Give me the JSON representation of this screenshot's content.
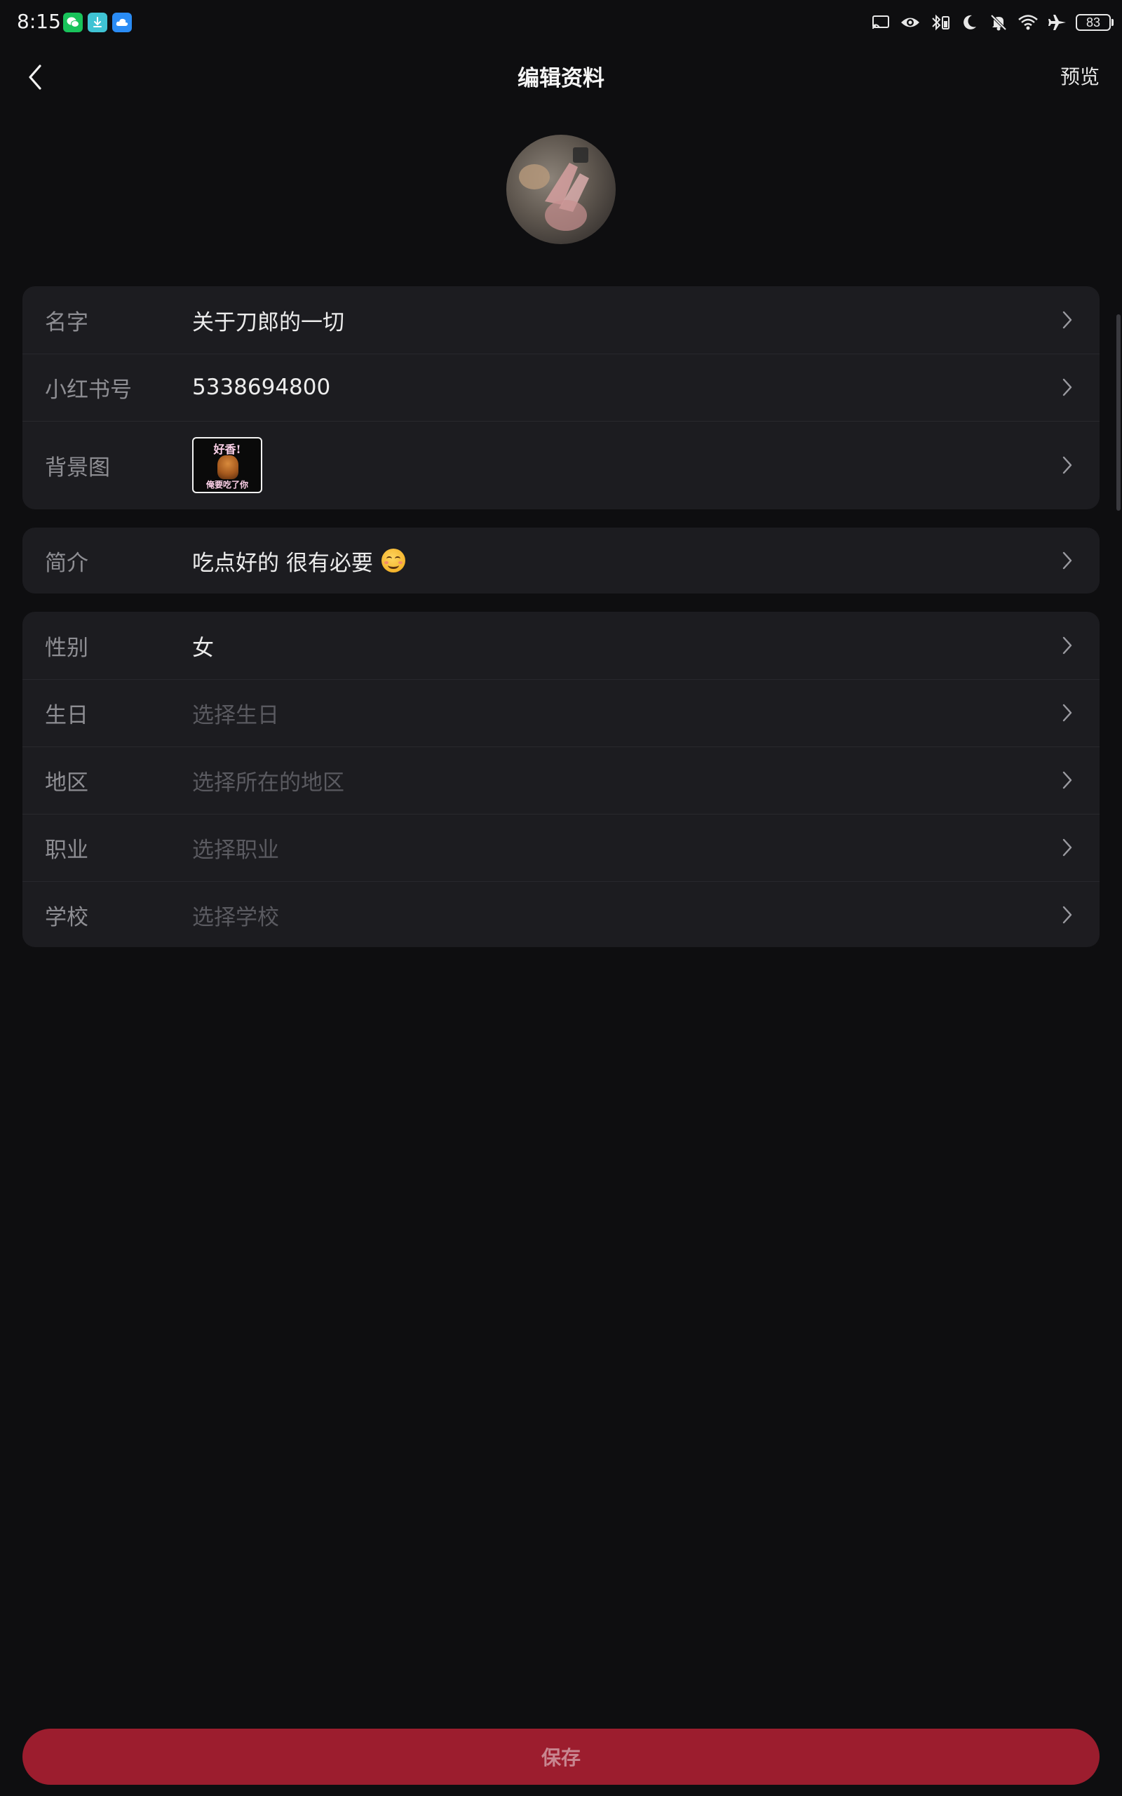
{
  "status_bar": {
    "time": "8:15",
    "battery": "83",
    "app_icons": [
      "wechat-icon",
      "download-icon",
      "cloud-icon"
    ],
    "system_icons": [
      "cast-icon",
      "eye-icon",
      "bluetooth-icon",
      "moon-icon",
      "bell-off-icon",
      "wifi-icon",
      "airplane-icon",
      "battery-icon"
    ]
  },
  "header": {
    "title": "编辑资料",
    "preview_label": "预览"
  },
  "basic_info": {
    "name": {
      "label": "名字",
      "value": "关于刀郎的一切"
    },
    "xhs_id": {
      "label": "小红书号",
      "value": "5338694800"
    },
    "background": {
      "label": "背景图",
      "thumb_top_text": "好香!",
      "thumb_bottom_text": "俺要吃了你"
    }
  },
  "bio": {
    "label": "简介",
    "value": "吃点好的 很有必要"
  },
  "details": {
    "gender": {
      "label": "性别",
      "value": "女"
    },
    "birthday": {
      "label": "生日",
      "placeholder": "选择生日"
    },
    "region": {
      "label": "地区",
      "placeholder": "选择所在的地区"
    },
    "occupation": {
      "label": "职业",
      "placeholder": "选择职业"
    },
    "school": {
      "label": "学校",
      "placeholder": "选择学校"
    }
  },
  "save_label": "保存",
  "colors": {
    "background": "#0e0e10",
    "card": "#1c1c20",
    "save_button": "#9c1d2e",
    "label_text": "#8e8e93",
    "placeholder_text": "#5a5a60"
  }
}
